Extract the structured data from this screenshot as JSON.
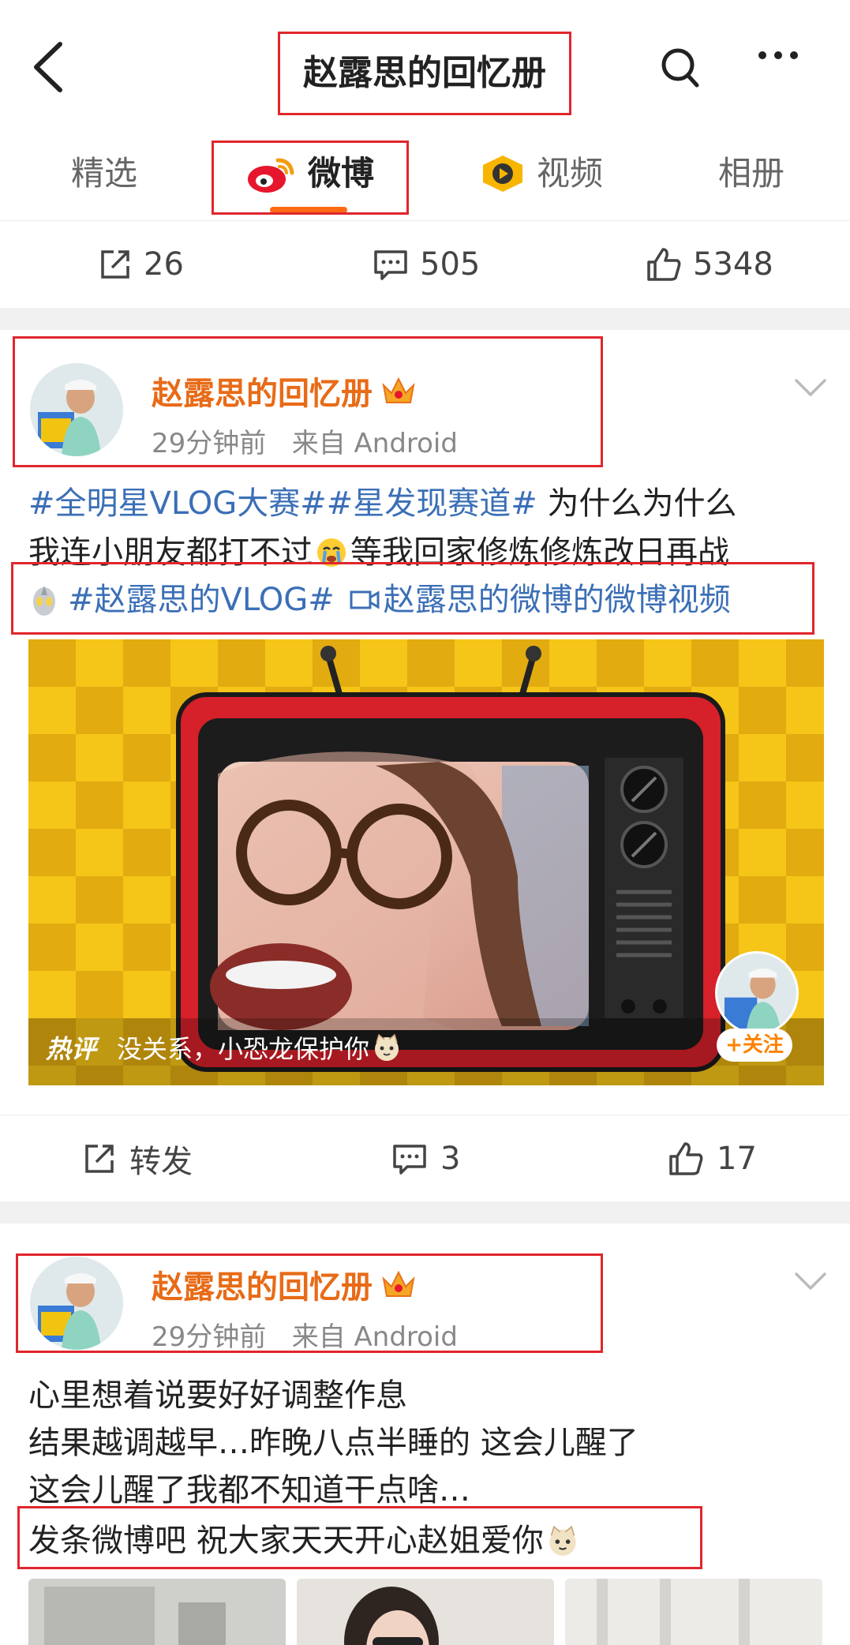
{
  "header": {
    "title": "赵露思的回忆册"
  },
  "tabs": [
    {
      "label": "精选"
    },
    {
      "label": "微博"
    },
    {
      "label": "视频"
    },
    {
      "label": "相册"
    }
  ],
  "stats": {
    "repost": "26",
    "comment": "505",
    "like": "5348"
  },
  "post1": {
    "user": "赵露思的回忆册",
    "time": "29分钟前",
    "source": "来自 Android",
    "tag1": "#全明星VLOG大赛#",
    "tag2": "#星发现赛道#",
    "text1": " 为什么为什么",
    "text2": "我连小朋友都打不过",
    "text3": " 等我回家修炼修炼改日再战",
    "tag3": "#赵露思的VLOG#",
    "video_link": "赵露思的微博的微博视频",
    "hot_label": "热评",
    "hot_comment": "没关系，小恐龙保护你",
    "follow_label": "+关注",
    "actions": {
      "repost": "转发",
      "comment": "3",
      "like": "17"
    }
  },
  "post2": {
    "user": "赵露思的回忆册",
    "time": "29分钟前",
    "source": "来自 Android",
    "line1": "心里想着说要好好调整作息",
    "line2": "结果越调越早…昨晚八点半睡的 这会儿醒了",
    "line3": "这会儿醒了我都不知道干点啥…",
    "line4": "发条微博吧 祝大家天天开心赵姐爱你"
  },
  "colors": {
    "accent": "#ff6a13",
    "username": "#e86b17",
    "link": "#3b6fb6",
    "annotation": "#e0262c"
  }
}
